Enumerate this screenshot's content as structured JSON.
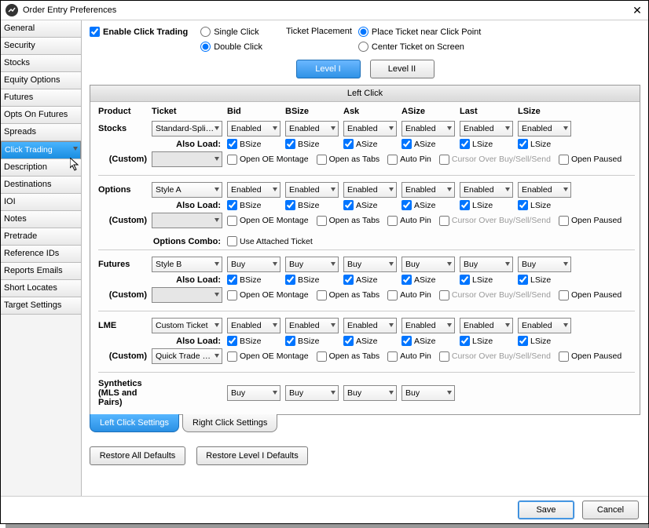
{
  "title": "Order Entry Preferences",
  "sidebar": {
    "items": [
      {
        "label": "General"
      },
      {
        "label": "Security"
      },
      {
        "label": "Stocks"
      },
      {
        "label": "Equity Options"
      },
      {
        "label": "Futures"
      },
      {
        "label": "Opts On Futures"
      },
      {
        "label": "Spreads"
      },
      {
        "label": "Click Trading",
        "selected": true
      },
      {
        "label": "Description"
      },
      {
        "label": "Destinations"
      },
      {
        "label": "IOI"
      },
      {
        "label": "Notes"
      },
      {
        "label": "Pretrade"
      },
      {
        "label": "Reference IDs"
      },
      {
        "label": "Reports Emails"
      },
      {
        "label": "Short Locates"
      },
      {
        "label": "Target Settings"
      }
    ]
  },
  "enable": {
    "label": "Enable Click Trading",
    "checked": true
  },
  "clickmode": {
    "single": "Single Click",
    "double": "Double Click",
    "value": "double"
  },
  "placement": {
    "label": "Ticket Placement",
    "near": "Place Ticket near Click Point",
    "center": "Center Ticket on Screen",
    "value": "near"
  },
  "levels": {
    "l1": "Level I",
    "l2": "Level II"
  },
  "panel": {
    "title": "Left Click"
  },
  "cols": {
    "product": "Product",
    "ticket": "Ticket",
    "bid": "Bid",
    "bsize": "BSize",
    "ask": "Ask",
    "asize": "ASize",
    "last": "Last",
    "lsize": "LSize"
  },
  "also": "Also Load:",
  "custom": "(Custom)",
  "custopts": {
    "oe": "Open OE Montage",
    "tabs": "Open as Tabs",
    "autopin": "Auto Pin",
    "cursor": "Cursor Over Buy/Sell/Send",
    "paused": "Open Paused"
  },
  "optcombo": {
    "label": "Options Combo:",
    "chk": "Use Attached Ticket"
  },
  "rows": {
    "stocks": {
      "name": "Stocks",
      "ticket": "Standard-Spli…",
      "vals": [
        "Enabled",
        "Enabled",
        "Enabled",
        "Enabled",
        "Enabled",
        "Enabled"
      ],
      "also": [
        "BSize",
        "BSize",
        "ASize",
        "ASize",
        "LSize",
        "LSize"
      ]
    },
    "options": {
      "name": "Options",
      "ticket": "Style A",
      "vals": [
        "Enabled",
        "Enabled",
        "Enabled",
        "Enabled",
        "Enabled",
        "Enabled"
      ],
      "also": [
        "BSize",
        "BSize",
        "ASize",
        "ASize",
        "LSize",
        "LSize"
      ]
    },
    "futures": {
      "name": "Futures",
      "ticket": "Style B",
      "vals": [
        "Buy",
        "Buy",
        "Buy",
        "Buy",
        "Buy",
        "Buy"
      ],
      "also": [
        "BSize",
        "BSize",
        "ASize",
        "ASize",
        "LSize",
        "LSize"
      ]
    },
    "lme": {
      "name": "LME",
      "ticket": "Custom Ticket",
      "custom": "Quick Trade …",
      "vals": [
        "Enabled",
        "Enabled",
        "Enabled",
        "Enabled",
        "Enabled",
        "Enabled"
      ],
      "also": [
        "BSize",
        "BSize",
        "ASize",
        "ASize",
        "LSize",
        "LSize"
      ]
    },
    "syn": {
      "name": "Synthetics",
      "name2": "(MLS and Pairs)",
      "vals": [
        "Buy",
        "Buy",
        "Buy",
        "Buy"
      ]
    }
  },
  "tabs": {
    "left": "Left Click Settings",
    "right": "Right Click Settings"
  },
  "restore": {
    "all": "Restore All Defaults",
    "lvl": "Restore Level I Defaults"
  },
  "footer": {
    "save": "Save",
    "cancel": "Cancel"
  }
}
